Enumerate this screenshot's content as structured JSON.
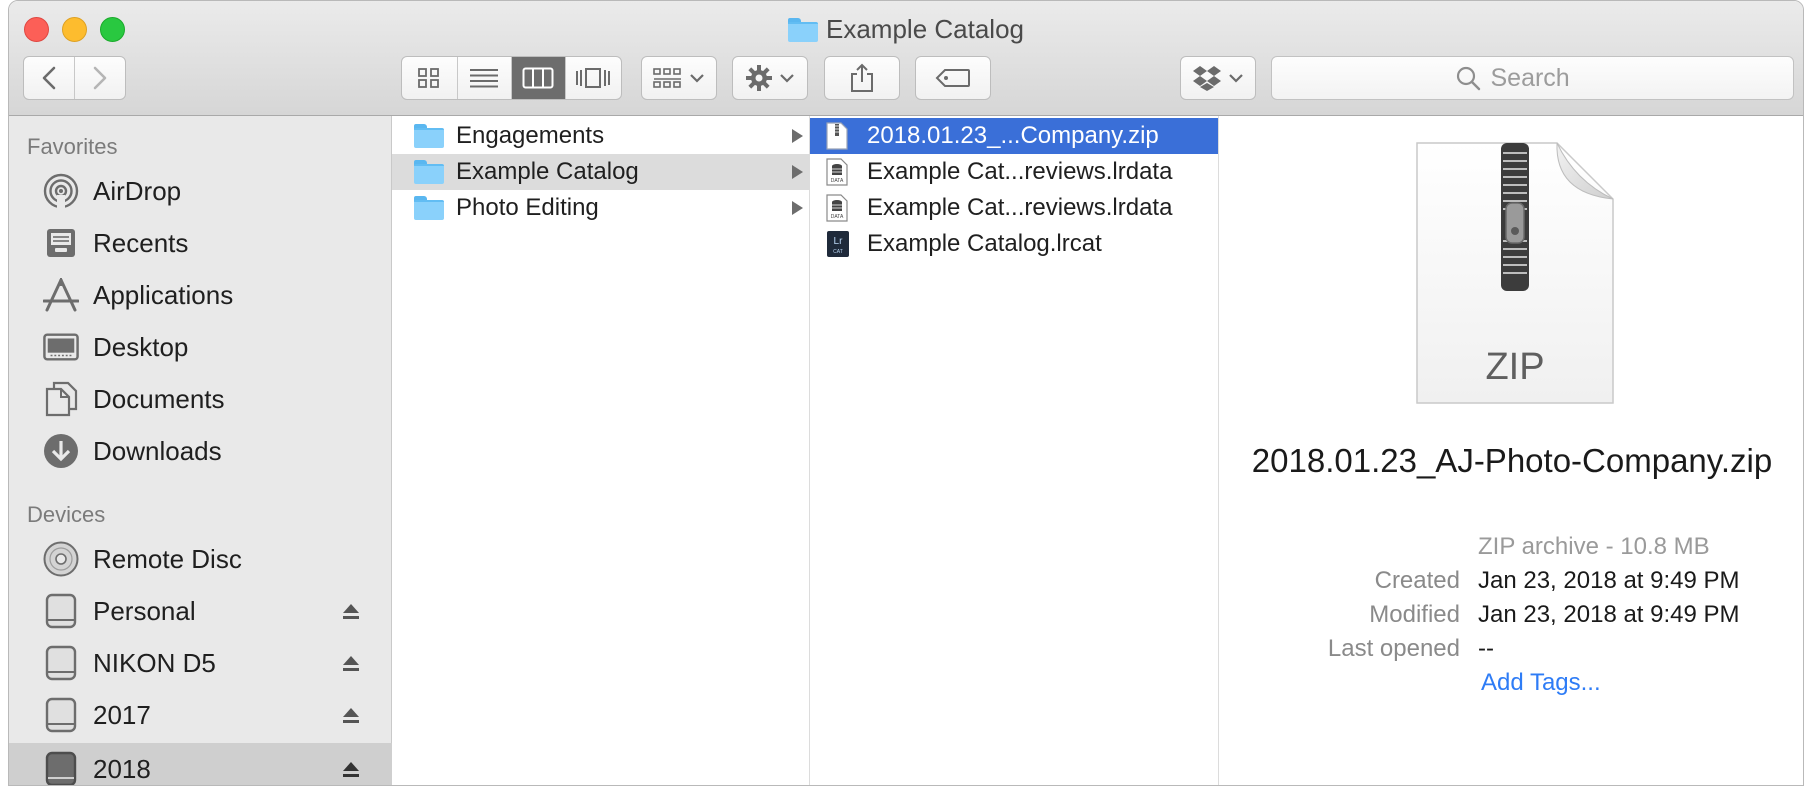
{
  "window": {
    "title": "Example Catalog"
  },
  "toolbar": {
    "search_placeholder": "Search",
    "view_modes": [
      "icon-view",
      "list-view",
      "column-view",
      "cover-flow-view"
    ],
    "active_view": "column-view"
  },
  "sidebar": {
    "favorites_heading": "Favorites",
    "favorites": [
      {
        "label": "AirDrop",
        "icon": "airdrop-icon"
      },
      {
        "label": "Recents",
        "icon": "recents-icon"
      },
      {
        "label": "Applications",
        "icon": "applications-icon"
      },
      {
        "label": "Desktop",
        "icon": "desktop-icon"
      },
      {
        "label": "Documents",
        "icon": "documents-icon"
      },
      {
        "label": "Downloads",
        "icon": "downloads-icon"
      }
    ],
    "devices_heading": "Devices",
    "devices": [
      {
        "label": "Remote Disc",
        "icon": "disc-icon",
        "eject": false
      },
      {
        "label": "Personal",
        "icon": "drive-icon",
        "eject": true
      },
      {
        "label": "NIKON D5",
        "icon": "drive-icon",
        "eject": true
      },
      {
        "label": "2017",
        "icon": "drive-icon",
        "eject": true
      },
      {
        "label": "2018",
        "icon": "drive-icon",
        "eject": true,
        "selected": true
      }
    ]
  },
  "column1": {
    "items": [
      {
        "label": "Engagements"
      },
      {
        "label": "Example Catalog",
        "selected": true
      },
      {
        "label": "Photo Editing"
      }
    ]
  },
  "column2": {
    "items": [
      {
        "label": "2018.01.23_...Company.zip",
        "icon": "zip-file-icon",
        "selected": true
      },
      {
        "label": "Example Cat...reviews.lrdata",
        "icon": "data-file-icon"
      },
      {
        "label": "Example Cat...reviews.lrdata",
        "icon": "data-file-icon"
      },
      {
        "label": "Example Catalog.lrcat",
        "icon": "lrcat-file-icon"
      }
    ]
  },
  "preview": {
    "icon_text": "ZIP",
    "filename": "2018.01.23_AJ-Photo-Company.zip",
    "kind": "ZIP archive - 10.8 MB",
    "created_label": "Created",
    "created_value": "Jan 23, 2018 at 9:49 PM",
    "modified_label": "Modified",
    "modified_value": "Jan 23, 2018 at 9:49 PM",
    "last_opened_label": "Last opened",
    "last_opened_value": "--",
    "add_tags": "Add Tags..."
  },
  "colors": {
    "selection_blue": "#3a6fd8",
    "folder_blue": "#8ad1fb",
    "link_blue": "#2e7cf6"
  }
}
